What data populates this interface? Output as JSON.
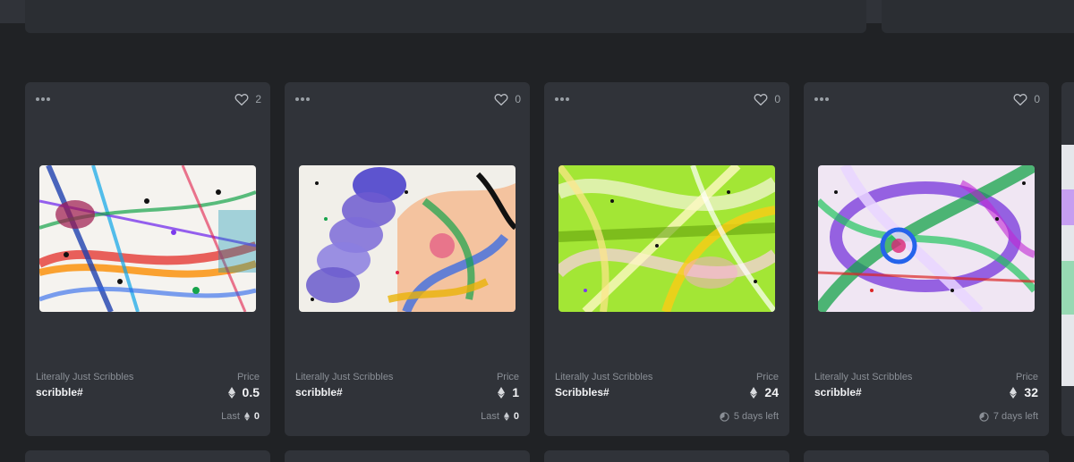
{
  "cards": [
    {
      "collection": "Literally Just Scribbles",
      "name": "scribble#",
      "likes": "2",
      "price_label": "Price",
      "price": "0.5",
      "footer_label": "Last",
      "footer_value": "0",
      "footer_type": "last"
    },
    {
      "collection": "Literally Just Scribbles",
      "name": "scribble#",
      "likes": "0",
      "price_label": "Price",
      "price": "1",
      "footer_label": "Last",
      "footer_value": "0",
      "footer_type": "last"
    },
    {
      "collection": "Literally Just Scribbles",
      "name": "Scribbles#",
      "likes": "0",
      "price_label": "Price",
      "price": "24",
      "footer_label": "5 days left",
      "footer_type": "time"
    },
    {
      "collection": "Literally Just Scribbles",
      "name": "scribble#",
      "likes": "0",
      "price_label": "Price",
      "price": "32",
      "footer_label": "7 days left",
      "footer_type": "time"
    }
  ],
  "icons": {
    "menu": "more-dots-icon",
    "like": "heart-icon",
    "currency": "ethereum-icon",
    "timer": "clock-icon"
  },
  "colors": {
    "page_bg": "#202225",
    "card_bg": "#303339",
    "muted_text": "#8a8f96"
  }
}
